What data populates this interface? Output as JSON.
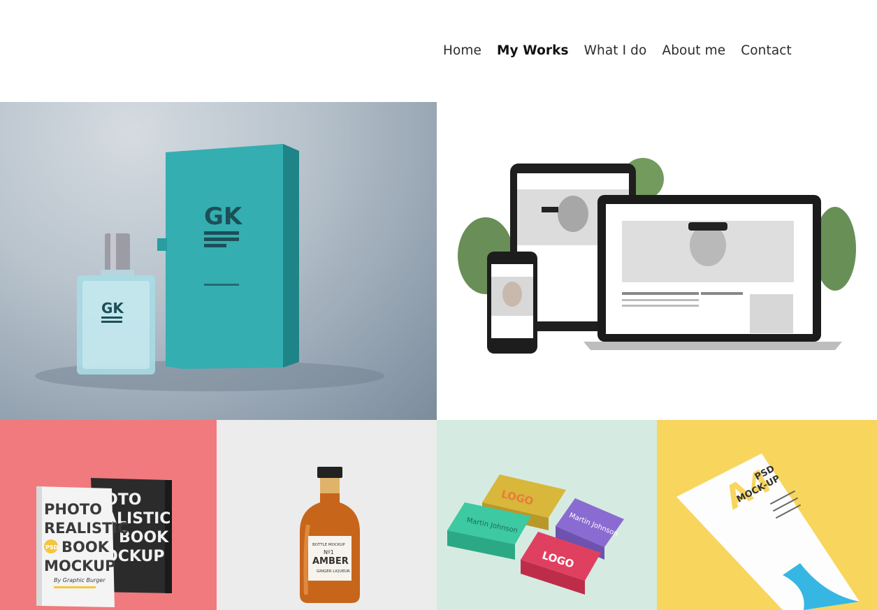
{
  "nav": {
    "items": [
      "Home",
      "My Works",
      "What I do",
      "About me",
      "Contact"
    ],
    "active": "My Works"
  },
  "portfolio": {
    "perfume": {
      "box_logo": "GK",
      "bottle_logo": "GK"
    },
    "book": {
      "cover_lines": [
        "PHOTO",
        "REALISTIC",
        "BOOK",
        "MOCKUP"
      ],
      "badge": "PSD",
      "byline": "By Graphic Burger"
    },
    "bottle": {
      "label_top": "BOTTLE MOCKUP",
      "label_num": "Nº1",
      "label_main": "AMBER",
      "label_sub": "GINGER LIQUEUR"
    },
    "cards": {
      "logo": "LOGO",
      "name": "Martin Johnson"
    },
    "paper": {
      "title_a": "A4",
      "title_psd": "PSD",
      "title_mockup": "MOCK-UP"
    }
  },
  "colors": {
    "perfume_box": "#2fa5a8",
    "book_bg": "#f07a7d",
    "bottle_bg": "#ececec",
    "cards_bg": "#d5ebe2",
    "paper_bg": "#f8d65e",
    "card_yellow": "#d8b73a",
    "card_green": "#3dc9a2",
    "card_purple": "#8a6bd1",
    "card_red": "#e0405f"
  }
}
